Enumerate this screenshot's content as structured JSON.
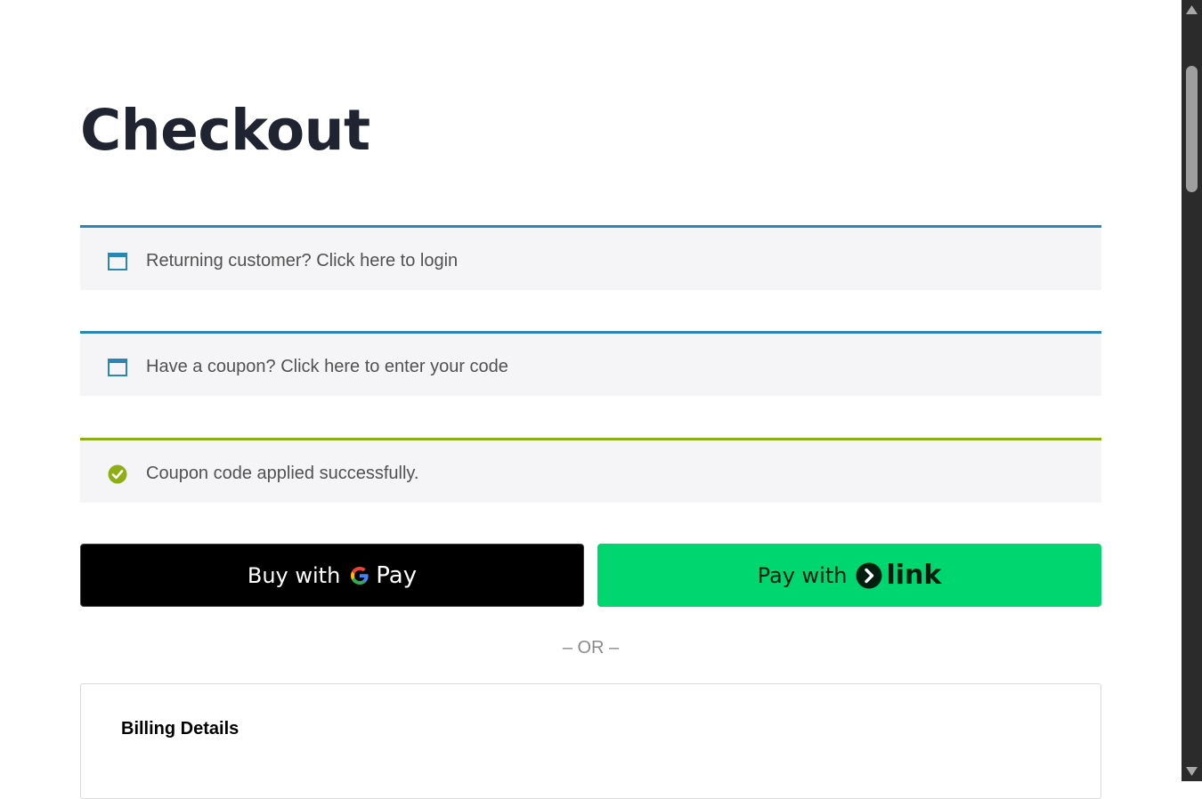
{
  "page": {
    "title": "Checkout"
  },
  "notices": {
    "login": {
      "text": "Returning customer? Click here to login",
      "icon": "window-icon"
    },
    "coupon": {
      "text": "Have a coupon? Click here to enter your code",
      "icon": "window-icon"
    },
    "success": {
      "text": "Coupon code applied successfully.",
      "icon": "check-circle-icon"
    }
  },
  "payment": {
    "gpay": {
      "prefix": "Buy with",
      "brand": "Pay",
      "icon": "google-g-icon"
    },
    "link": {
      "prefix": "Pay with",
      "brand": "link",
      "icon": "link-arrow-icon"
    }
  },
  "divider": {
    "text": "– OR –"
  },
  "billing": {
    "heading": "Billing Details"
  },
  "colors": {
    "info_accent": "#2a86b4",
    "success_accent": "#8fad15",
    "link_green": "#00d66f",
    "notice_bg": "#f5f5f7",
    "title": "#1f2430"
  }
}
